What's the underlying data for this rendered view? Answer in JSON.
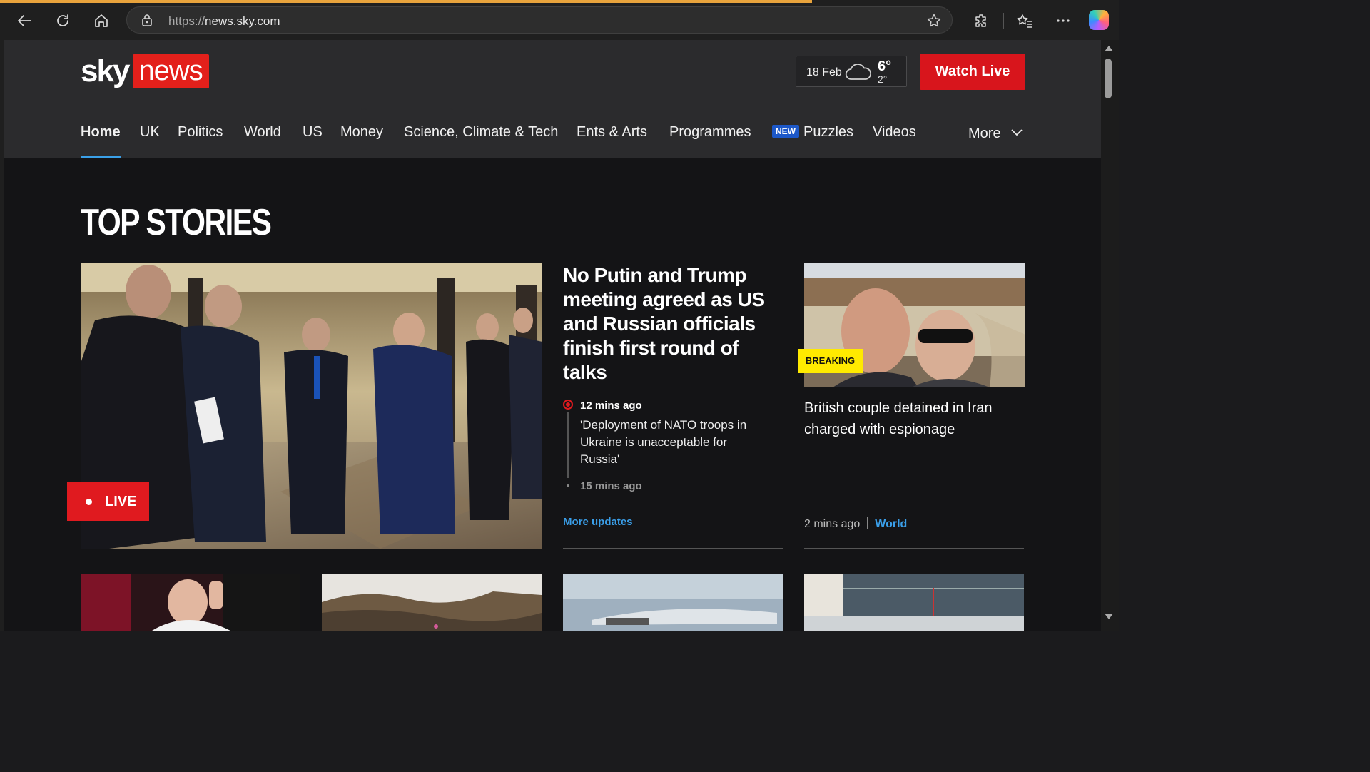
{
  "browser": {
    "url_protocol": "https://",
    "url_host": "news.sky.com"
  },
  "header": {
    "logo_sky": "sky",
    "logo_news": "news",
    "weather_date": "18 Feb",
    "weather_high": "6°",
    "weather_low": "2°",
    "weather_icon": "cloud-icon",
    "watch_live_label": "Watch Live"
  },
  "nav": {
    "items": [
      {
        "label": "Home",
        "active": true
      },
      {
        "label": "UK"
      },
      {
        "label": "Politics"
      },
      {
        "label": "World"
      },
      {
        "label": "US"
      },
      {
        "label": "Money"
      },
      {
        "label": "Science, Climate & Tech"
      },
      {
        "label": "Ents & Arts"
      },
      {
        "label": "Programmes"
      },
      {
        "label": "Puzzles",
        "badge": "NEW"
      },
      {
        "label": "Videos"
      },
      {
        "label": "More"
      }
    ]
  },
  "main": {
    "section_title": "TOP STORIES",
    "hero": {
      "badge": "LIVE",
      "title": "No Putin and Trump meeting agreed as US and Russian officials finish first round of talks",
      "update1_time": "12 mins ago",
      "update1_text": "'Deployment of NATO troops in Ukraine is unacceptable for Russia'",
      "update2_time": "15 mins ago",
      "more_updates": "More updates"
    },
    "side_story": {
      "badge": "BREAKING",
      "title": "British couple detained in Iran charged with espionage",
      "time": "2 mins ago",
      "category": "World"
    }
  },
  "colors": {
    "brand_red": "#e3201b",
    "link_blue": "#3a9ee8",
    "breaking_yellow": "#ffea00",
    "tab_accent": "#e8a33c"
  }
}
